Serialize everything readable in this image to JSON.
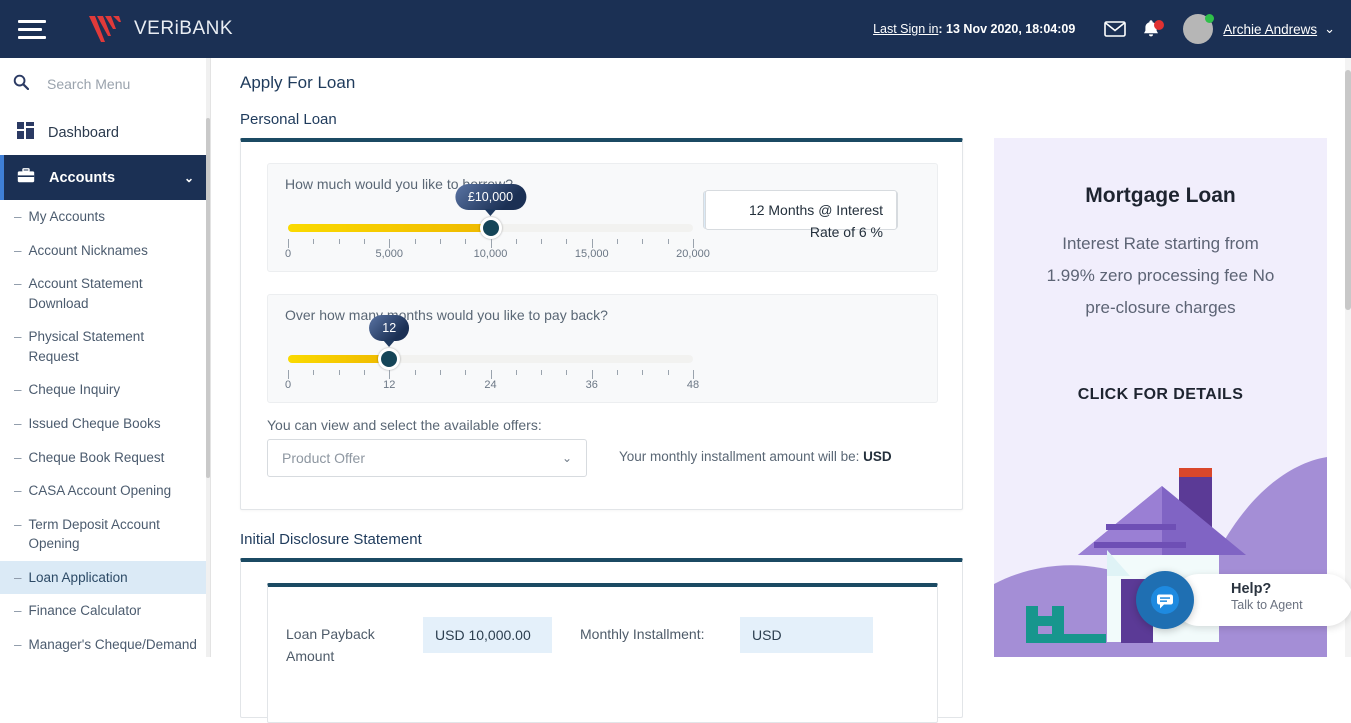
{
  "topbar": {
    "brand_name": "VERiBANK",
    "last_signin_label": "Last Sign in",
    "last_signin_value": ": 13 Nov 2020, 18:04:09",
    "username": "Archie Andrews",
    "chevron": "⌄",
    "accent_navy": "#1b3054",
    "logo_red": "#e03a3a"
  },
  "sidebar": {
    "search_placeholder": "Search Menu",
    "dashboard_label": "Dashboard",
    "accounts_label": "Accounts",
    "accounts_chevron": "⌄",
    "sub_items": [
      {
        "label": "My Accounts",
        "selected": false
      },
      {
        "label": "Account Nicknames",
        "selected": false
      },
      {
        "label": "Account Statement Download",
        "selected": false
      },
      {
        "label": "Physical Statement Request",
        "selected": false
      },
      {
        "label": "Cheque Inquiry",
        "selected": false
      },
      {
        "label": "Issued Cheque Books",
        "selected": false
      },
      {
        "label": "Cheque Book Request",
        "selected": false
      },
      {
        "label": "CASA Account Opening",
        "selected": false
      },
      {
        "label": "Term Deposit Account Opening",
        "selected": false
      },
      {
        "label": "Loan Application",
        "selected": true
      },
      {
        "label": "Finance Calculator",
        "selected": false
      },
      {
        "label": "Manager's Cheque/Demand Draft",
        "selected": false
      }
    ]
  },
  "main": {
    "page_title": "Apply For Loan",
    "section1_title": "Personal Loan",
    "section2_title": "Initial Disclosure Statement",
    "amount": {
      "question": "How much would you like to borrow?",
      "bubble": "£10,000",
      "currency": "USD",
      "value": "10,000.00",
      "fill_percent": 50,
      "tick_labels": [
        "0",
        "5,000",
        "10,000",
        "15,000",
        "20,000"
      ],
      "track_color": "#f5c800"
    },
    "months": {
      "question": "Over how many months would you like to pay back?",
      "bubble": "12",
      "box_line1": "12 Months @ Interest",
      "box_line2": "Rate of 6 %",
      "fill_percent": 25,
      "tick_labels": [
        "0",
        "12",
        "24",
        "36",
        "48"
      ]
    },
    "offers": {
      "label": "You can view and select the available offers:",
      "select_value": "Product Offer",
      "chevron": "⌄",
      "installment_prefix": "Your monthly installment amount will be: ",
      "installment_currency": "USD"
    },
    "disclosure": {
      "payback_label": "Loan Payback Amount",
      "payback_value": "USD 10,000.00",
      "installment_label": "Monthly Installment:",
      "installment_value": "USD"
    }
  },
  "promo": {
    "title": "Mortgage Loan",
    "body": "Interest Rate starting from 1.99% zero processing fee No pre-closure charges",
    "cta": "CLICK FOR DETAILS",
    "background": "#f1eefc"
  },
  "chat": {
    "title": "Help?",
    "subtitle": "Talk to Agent",
    "circle_color": "#1f6fb2"
  }
}
